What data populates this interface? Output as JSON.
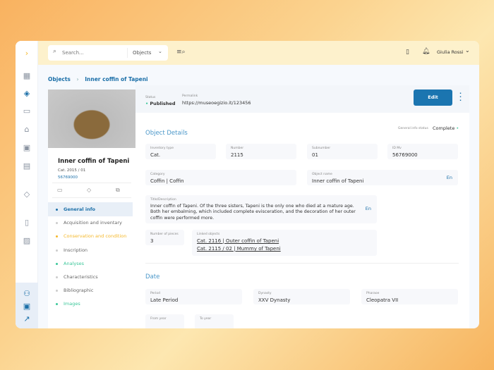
{
  "topbar": {
    "search_placeholder": "Search...",
    "scope": "Objects",
    "user": "Giulia Rossi"
  },
  "breadcrumb": {
    "root": "Objects",
    "current": "Inner coffin of Tapeni"
  },
  "object": {
    "title": "Inner coffin of Tapeni",
    "catalog": "Cat. 2015 / 01",
    "id": "56769000"
  },
  "nav": [
    {
      "label": "General info",
      "color": "#1b6fa8",
      "dot": "#1b6fa8"
    },
    {
      "label": "Acquisition and inventary",
      "color": "#666",
      "dot": "#ccc"
    },
    {
      "label": "Conservation and condition",
      "color": "#f5b82a",
      "dot": "#f5b82a"
    },
    {
      "label": "Inscription",
      "color": "#666",
      "dot": "#ccc"
    },
    {
      "label": "Analyses",
      "color": "#3cc79a",
      "dot": "#3cc79a"
    },
    {
      "label": "Characteristics",
      "color": "#666",
      "dot": "#ccc"
    },
    {
      "label": "Bibliographic",
      "color": "#666",
      "dot": "#ccc"
    },
    {
      "label": "Images",
      "color": "#3cc79a",
      "dot": "#3cc79a"
    }
  ],
  "header": {
    "status_label": "Status",
    "status": "Published",
    "permalink_label": "Permalink",
    "permalink": "https://museoegizio.it/123456",
    "edit": "Edit"
  },
  "details": {
    "title": "Object Details",
    "info_status_label": "General info status",
    "info_status": "Complete",
    "inventory_type_label": "Inventory type",
    "inventory_type": "Cat.",
    "number_label": "Number",
    "number": "2115",
    "subnumber_label": "Subnumber",
    "subnumber": "01",
    "idmv_label": "ID Mv",
    "idmv": "56769000",
    "category_label": "Category",
    "category": "Coffin | Coffin",
    "object_name_label": "Object name",
    "object_name": "Inner coffin of Tapeni",
    "lang": "En",
    "desc_label": "Title/Description",
    "desc": "Inner coffin of Tapeni. Of the three sisters, Tapeni is the only one who died at a mature age. Both her embalming, which included complete evisceration, and the decoration of her outer coffin were performed more.",
    "pieces_label": "Number of pieces",
    "pieces": "3",
    "linked_label": "Linked objects",
    "linked": [
      "Cat. 2116 | Outer coffin of Tapeni",
      "Cat. 2115 / 02 | Mummy of Tapeni"
    ]
  },
  "date": {
    "title": "Date",
    "period_label": "Period",
    "period": "Late Period",
    "dynasty_label": "Dynasty",
    "dynasty": "XXV Dynasty",
    "pharaoh_label": "Pharaoe",
    "pharaoh": "Cleopatra VII",
    "from_label": "From year",
    "to_label": "To year"
  }
}
